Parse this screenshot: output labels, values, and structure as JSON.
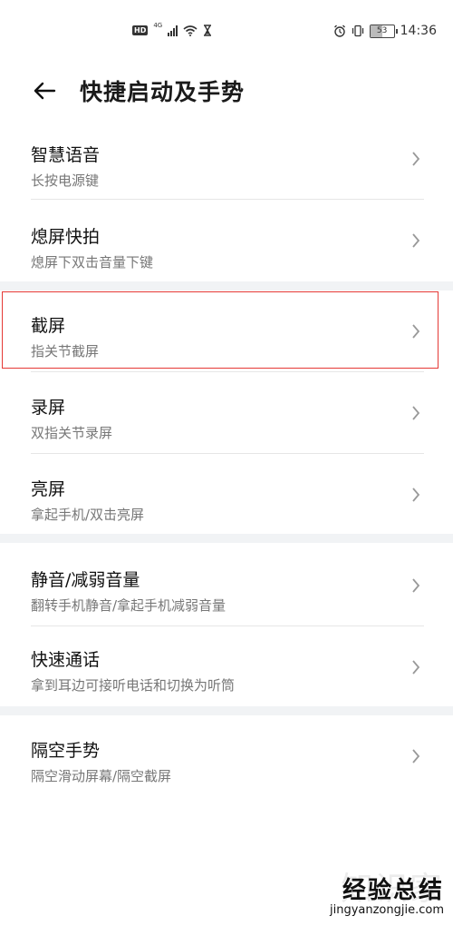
{
  "status_bar": {
    "hd": "HD",
    "network": "4G",
    "battery": "53",
    "battery_level": 0.53,
    "time": "14:36",
    "icons": [
      "signal-icon",
      "wifi-icon",
      "hourglass-icon",
      "alarm-icon",
      "vibrate-icon",
      "battery-icon"
    ]
  },
  "header": {
    "title": "快捷启动及手势"
  },
  "items": [
    {
      "title": "智慧语音",
      "sub": "长按电源键"
    },
    {
      "title": "熄屏快拍",
      "sub": "熄屏下双击音量下键"
    },
    {
      "title": "截屏",
      "sub": "指关节截屏",
      "highlighted": true
    },
    {
      "title": "录屏",
      "sub": "双指关节录屏"
    },
    {
      "title": "亮屏",
      "sub": "拿起手机/双击亮屏"
    },
    {
      "title": "静音/减弱音量",
      "sub": "翻转手机静音/拿起手机减弱音量"
    },
    {
      "title": "快速通话",
      "sub": "拿到耳边可接听电话和切换为听筒"
    },
    {
      "title": "隔空手势",
      "sub": "隔空滑动屏幕/隔空截屏"
    }
  ],
  "watermark": {
    "main": "经验总结",
    "bg": "知识家",
    "url": "jingyanzongjie.com"
  },
  "colors": {
    "highlight": "#e53935",
    "gap": "#f1f3f5",
    "subtitle": "#777777"
  }
}
